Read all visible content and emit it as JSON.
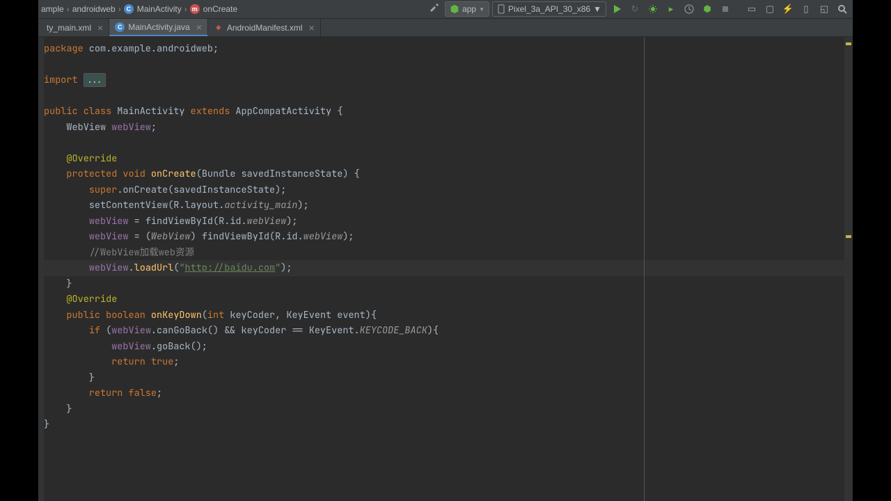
{
  "breadcrumbs": {
    "items": [
      "ample",
      "androidweb",
      "MainActivity",
      "onCreate"
    ]
  },
  "toolbar": {
    "config": "app",
    "device": "Pixel_3a_API_30_x86"
  },
  "tabs": [
    {
      "label": "ty_main.xml",
      "type": "xml",
      "active": false
    },
    {
      "label": "MainActivity.java",
      "type": "java",
      "active": true
    },
    {
      "label": "AndroidManifest.xml",
      "type": "xml",
      "active": false
    }
  ],
  "code": {
    "l1_kw": "package",
    "l1_rest": " com.example.androidweb;",
    "l3_kw": "import",
    "l3_fold": "...",
    "l5_a": "public class",
    "l5_b": " MainActivity ",
    "l5_c": "extends",
    "l5_d": " AppCompatActivity {",
    "l6": "    WebView ",
    "l6_f": "webView",
    "l6_e": ";",
    "l8": "    ",
    "l8_anno": "@Override",
    "l9_a": "    ",
    "l9_b": "protected void",
    "l9_c": " ",
    "l9_m": "onCreate",
    "l9_d": "(Bundle savedInstanceState) {",
    "l10_a": "        ",
    "l10_b": "super",
    "l10_c": ".onCreate(savedInstanceState);",
    "l11_a": "        setContentView(R.layout.",
    "l11_b": "activity_main",
    "l11_c": ");",
    "l12_a": "        ",
    "l12_f": "webView",
    "l12_b": " = findViewById(R.id.",
    "l12_c": "webView",
    "l12_d": ");",
    "l13_a": "        ",
    "l13_f": "webView",
    "l13_b": " = (",
    "l13_c": "WebView",
    "l13_d": ") findViewById(R.id.",
    "l13_e": "webView",
    "l13_g": ");",
    "l14_a": "        ",
    "l14_c": "//WebView加载web资源",
    "l15_a": "        ",
    "l15_f": "webView",
    "l15_b": ".",
    "l15_m": "loadUrl",
    "l15_c": "(",
    "l15_s1": "\"",
    "l15_url": "http://baidu.com",
    "l15_s2": "\"",
    "l15_d": ");",
    "l16": "    }",
    "l17": "    ",
    "l17_anno": "@Override",
    "l18_a": "    ",
    "l18_b": "public boolean",
    "l18_c": " ",
    "l18_m": "onKeyDown",
    "l18_d": "(",
    "l18_e": "int",
    "l18_f": " keyCoder, KeyEvent event){",
    "l19_a": "        ",
    "l19_b": "if",
    "l19_c": " (",
    "l19_f": "webView",
    "l19_d": ".canGoBack() && keyCoder == KeyEvent.",
    "l19_e": "KEYCODE_BACK",
    "l19_g": "){",
    "l20_a": "            ",
    "l20_f": "webView",
    "l20_b": ".goBack();",
    "l21_a": "            ",
    "l21_b": "return true",
    "l21_c": ";",
    "l22": "        }",
    "l23_a": "        ",
    "l23_b": "return false",
    "l23_c": ";",
    "l24": "    }",
    "l25": "}"
  }
}
